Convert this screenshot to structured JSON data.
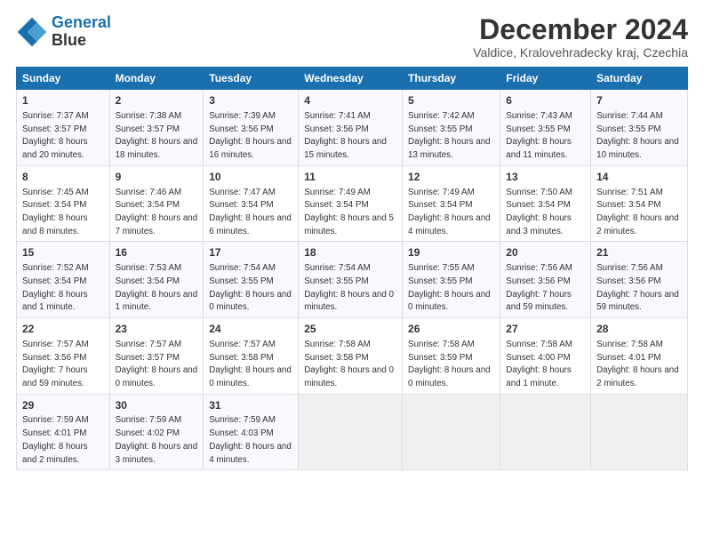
{
  "logo": {
    "line1": "General",
    "line2": "Blue"
  },
  "title": "December 2024",
  "subtitle": "Valdice, Kralovehradecky kraj, Czechia",
  "headers": [
    "Sunday",
    "Monday",
    "Tuesday",
    "Wednesday",
    "Thursday",
    "Friday",
    "Saturday"
  ],
  "weeks": [
    [
      {
        "day": "1",
        "sunrise": "7:37 AM",
        "sunset": "3:57 PM",
        "daylight": "8 hours and 20 minutes."
      },
      {
        "day": "2",
        "sunrise": "7:38 AM",
        "sunset": "3:57 PM",
        "daylight": "8 hours and 18 minutes."
      },
      {
        "day": "3",
        "sunrise": "7:39 AM",
        "sunset": "3:56 PM",
        "daylight": "8 hours and 16 minutes."
      },
      {
        "day": "4",
        "sunrise": "7:41 AM",
        "sunset": "3:56 PM",
        "daylight": "8 hours and 15 minutes."
      },
      {
        "day": "5",
        "sunrise": "7:42 AM",
        "sunset": "3:55 PM",
        "daylight": "8 hours and 13 minutes."
      },
      {
        "day": "6",
        "sunrise": "7:43 AM",
        "sunset": "3:55 PM",
        "daylight": "8 hours and 11 minutes."
      },
      {
        "day": "7",
        "sunrise": "7:44 AM",
        "sunset": "3:55 PM",
        "daylight": "8 hours and 10 minutes."
      }
    ],
    [
      {
        "day": "8",
        "sunrise": "7:45 AM",
        "sunset": "3:54 PM",
        "daylight": "8 hours and 8 minutes."
      },
      {
        "day": "9",
        "sunrise": "7:46 AM",
        "sunset": "3:54 PM",
        "daylight": "8 hours and 7 minutes."
      },
      {
        "day": "10",
        "sunrise": "7:47 AM",
        "sunset": "3:54 PM",
        "daylight": "8 hours and 6 minutes."
      },
      {
        "day": "11",
        "sunrise": "7:49 AM",
        "sunset": "3:54 PM",
        "daylight": "8 hours and 5 minutes."
      },
      {
        "day": "12",
        "sunrise": "7:49 AM",
        "sunset": "3:54 PM",
        "daylight": "8 hours and 4 minutes."
      },
      {
        "day": "13",
        "sunrise": "7:50 AM",
        "sunset": "3:54 PM",
        "daylight": "8 hours and 3 minutes."
      },
      {
        "day": "14",
        "sunrise": "7:51 AM",
        "sunset": "3:54 PM",
        "daylight": "8 hours and 2 minutes."
      }
    ],
    [
      {
        "day": "15",
        "sunrise": "7:52 AM",
        "sunset": "3:54 PM",
        "daylight": "8 hours and 1 minute."
      },
      {
        "day": "16",
        "sunrise": "7:53 AM",
        "sunset": "3:54 PM",
        "daylight": "8 hours and 1 minute."
      },
      {
        "day": "17",
        "sunrise": "7:54 AM",
        "sunset": "3:55 PM",
        "daylight": "8 hours and 0 minutes."
      },
      {
        "day": "18",
        "sunrise": "7:54 AM",
        "sunset": "3:55 PM",
        "daylight": "8 hours and 0 minutes."
      },
      {
        "day": "19",
        "sunrise": "7:55 AM",
        "sunset": "3:55 PM",
        "daylight": "8 hours and 0 minutes."
      },
      {
        "day": "20",
        "sunrise": "7:56 AM",
        "sunset": "3:56 PM",
        "daylight": "7 hours and 59 minutes."
      },
      {
        "day": "21",
        "sunrise": "7:56 AM",
        "sunset": "3:56 PM",
        "daylight": "7 hours and 59 minutes."
      }
    ],
    [
      {
        "day": "22",
        "sunrise": "7:57 AM",
        "sunset": "3:56 PM",
        "daylight": "7 hours and 59 minutes."
      },
      {
        "day": "23",
        "sunrise": "7:57 AM",
        "sunset": "3:57 PM",
        "daylight": "8 hours and 0 minutes."
      },
      {
        "day": "24",
        "sunrise": "7:57 AM",
        "sunset": "3:58 PM",
        "daylight": "8 hours and 0 minutes."
      },
      {
        "day": "25",
        "sunrise": "7:58 AM",
        "sunset": "3:58 PM",
        "daylight": "8 hours and 0 minutes."
      },
      {
        "day": "26",
        "sunrise": "7:58 AM",
        "sunset": "3:59 PM",
        "daylight": "8 hours and 0 minutes."
      },
      {
        "day": "27",
        "sunrise": "7:58 AM",
        "sunset": "4:00 PM",
        "daylight": "8 hours and 1 minute."
      },
      {
        "day": "28",
        "sunrise": "7:58 AM",
        "sunset": "4:01 PM",
        "daylight": "8 hours and 2 minutes."
      }
    ],
    [
      {
        "day": "29",
        "sunrise": "7:59 AM",
        "sunset": "4:01 PM",
        "daylight": "8 hours and 2 minutes."
      },
      {
        "day": "30",
        "sunrise": "7:59 AM",
        "sunset": "4:02 PM",
        "daylight": "8 hours and 3 minutes."
      },
      {
        "day": "31",
        "sunrise": "7:59 AM",
        "sunset": "4:03 PM",
        "daylight": "8 hours and 4 minutes."
      },
      null,
      null,
      null,
      null
    ]
  ]
}
